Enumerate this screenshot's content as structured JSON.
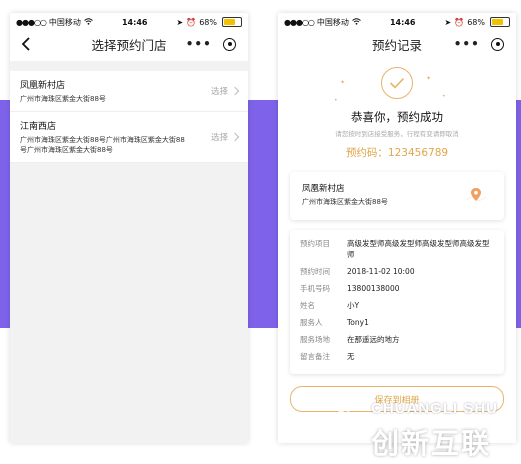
{
  "colors": {
    "accent": "#7e63ea",
    "gold": "#e0a64a",
    "battery": "#f2c200"
  },
  "statusbar": {
    "carrier": "中国移动",
    "time": "14:46",
    "battery": "68%"
  },
  "left": {
    "title": "选择预约门店",
    "stores": [
      {
        "name": "凤凰新村店",
        "address": "广州市海珠区紫金大街88号",
        "action": "选择"
      },
      {
        "name": "江南西店",
        "address": "广州市海珠区紫金大街88号广州市海珠区紫金大街88号广州市海珠区紫金大街88号",
        "action": "选择"
      }
    ]
  },
  "right": {
    "title": "预约记录",
    "success_title": "恭喜你，预约成功",
    "hint": "请您按时到店接受服务，行程有变请即取消",
    "code_line": "预约码：123456789",
    "store": {
      "name": "凤凰新村店",
      "address": "广州市海珠区紫金大街88号"
    },
    "details": [
      {
        "label": "预约项目",
        "value": "高级发型师高级发型师高级发型师高级发型师"
      },
      {
        "label": "预约时间",
        "value": "2018-11-02 10:00"
      },
      {
        "label": "手机号码",
        "value": "13800138000"
      },
      {
        "label": "姓名",
        "value": "小Y"
      },
      {
        "label": "服务人",
        "value": "Tony1"
      },
      {
        "label": "服务场地",
        "value": "在那遥远的地方"
      },
      {
        "label": "留言备注",
        "value": "无"
      }
    ],
    "save_button": "保存到相册"
  },
  "watermark": {
    "en": "CHUANGLI SHU",
    "cn": "创新互联"
  }
}
